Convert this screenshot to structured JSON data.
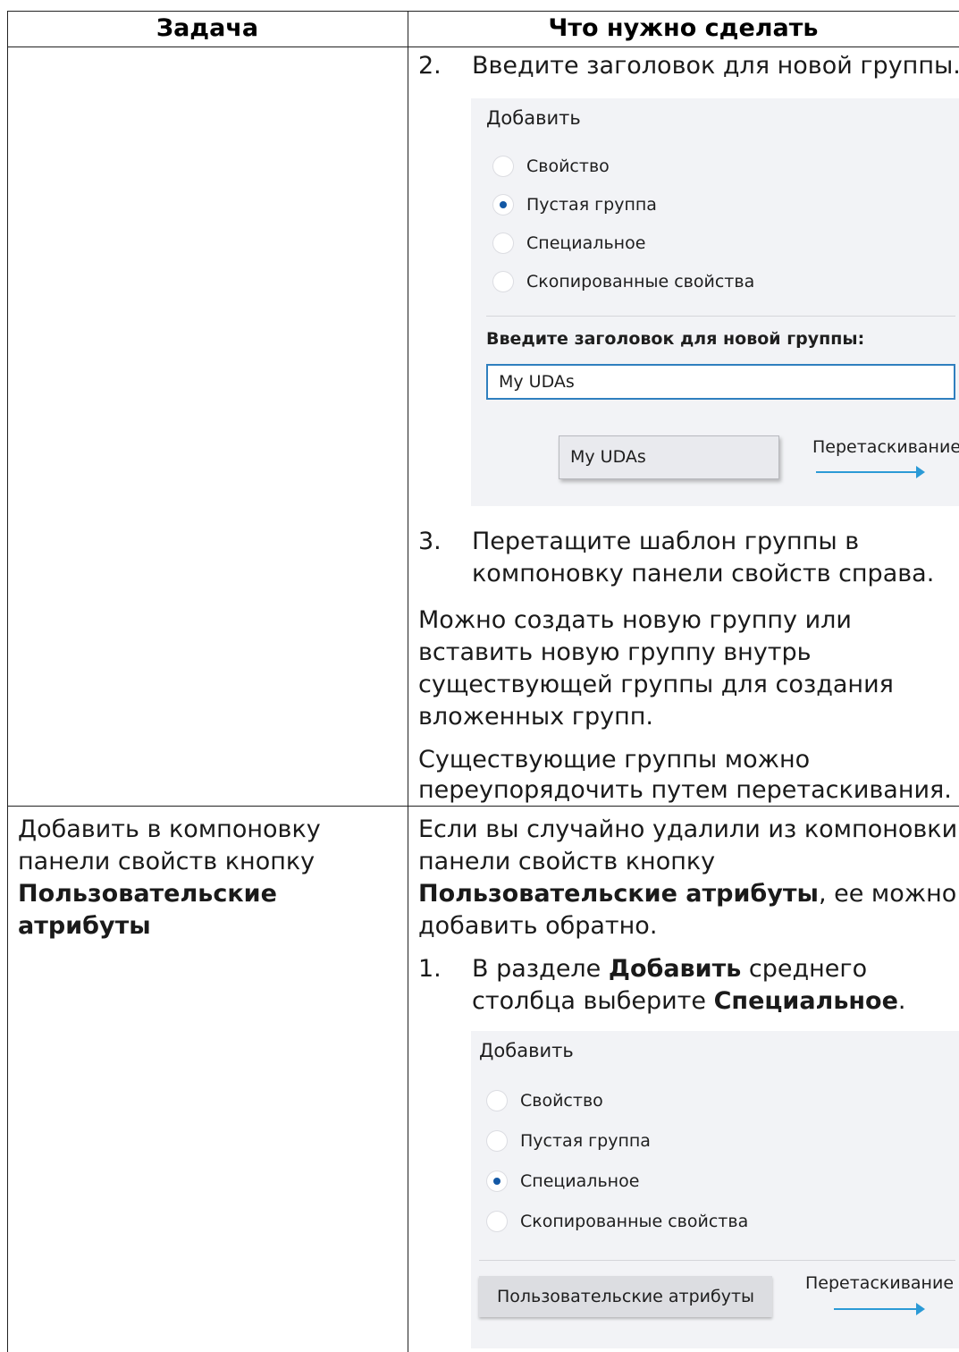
{
  "table": {
    "headers": {
      "task": "Задача",
      "action": "Что нужно сделать"
    }
  },
  "row1": {
    "step2": {
      "number": "2.",
      "text": "Введите заголовок для новой группы."
    },
    "panel": {
      "title": "Добавить",
      "options": [
        "Свойство",
        "Пустая группа",
        "Специальное",
        "Скопированные свойства"
      ],
      "selected": "Пустая группа",
      "field_label": "Введите заголовок для новой группы:",
      "input_value": "My UDAs",
      "tile_label": "My UDAs",
      "drag_label": "Перетаскивание"
    },
    "step3": {
      "number": "3.",
      "line1": "Перетащите шаблон группы в",
      "line2": "компоновку панели свойств справа."
    },
    "para1": [
      "Можно создать новую группу или",
      "вставить новую группу внутрь",
      "существующей группы для создания",
      "вложенных групп."
    ],
    "para2": [
      "Существующие группы можно",
      "переупорядочить путем перетаскивания."
    ]
  },
  "row2": {
    "task": {
      "line1": "Добавить в компоновку",
      "line2": "панели свойств кнопку",
      "line3": "Пользовательские",
      "line4": "атрибуты"
    },
    "intro": {
      "line1": "Если вы случайно удалили из компоновки",
      "line2": "панели свойств кнопку",
      "line3_bold": "Пользовательские атрибуты",
      "line3_rest": ", ее можно",
      "line4": "добавить обратно."
    },
    "step1": {
      "number": "1.",
      "prefix": "В разделе ",
      "bold1": "Добавить",
      "suffix": " среднего",
      "line2_prefix": "столбца выберите ",
      "bold2": "Специальное",
      "line2_suffix": "."
    },
    "panel": {
      "title": "Добавить",
      "options": [
        "Свойство",
        "Пустая группа",
        "Специальное",
        "Скопированные свойства"
      ],
      "selected": "Специальное",
      "tile_label": "Пользовательские атрибуты",
      "drag_label": "Перетаскивание"
    }
  }
}
